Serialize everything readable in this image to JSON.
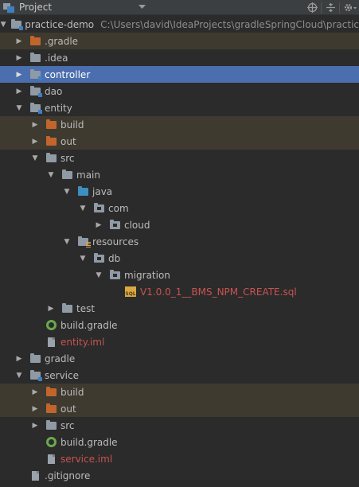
{
  "panel": {
    "title": "Project"
  },
  "colors": {
    "selected": "#4b6eaf",
    "excluded": "#3e3a30",
    "error_file": "#c75450"
  },
  "tree": [
    {
      "label": "practice-demo",
      "path": "C:\\Users\\david\\IdeaProjects\\gradleSpringCloud\\practic",
      "icon": "module-folder-icon",
      "arrow": "expanded"
    },
    {
      "label": ".gradle",
      "icon": "excluded-folder-icon",
      "arrow": "collapsed"
    },
    {
      "label": ".idea",
      "icon": "folder-icon",
      "arrow": "collapsed"
    },
    {
      "label": "controller",
      "icon": "module-folder-icon",
      "arrow": "collapsed"
    },
    {
      "label": "dao",
      "icon": "module-folder-icon",
      "arrow": "collapsed"
    },
    {
      "label": "entity",
      "icon": "module-folder-icon",
      "arrow": "expanded"
    },
    {
      "label": "build",
      "icon": "excluded-folder-icon",
      "arrow": "collapsed"
    },
    {
      "label": "out",
      "icon": "excluded-folder-icon",
      "arrow": "collapsed"
    },
    {
      "label": "src",
      "icon": "folder-icon",
      "arrow": "expanded"
    },
    {
      "label": "main",
      "icon": "folder-icon",
      "arrow": "expanded"
    },
    {
      "label": "java",
      "icon": "source-folder-icon",
      "arrow": "expanded"
    },
    {
      "label": "com",
      "icon": "package-icon",
      "arrow": "expanded"
    },
    {
      "label": "cloud",
      "icon": "package-icon",
      "arrow": "collapsed"
    },
    {
      "label": "resources",
      "icon": "resources-folder-icon",
      "arrow": "expanded"
    },
    {
      "label": "db",
      "icon": "package-icon",
      "arrow": "expanded"
    },
    {
      "label": "migration",
      "icon": "package-icon",
      "arrow": "expanded"
    },
    {
      "label": "V1.0.0_1__BMS_NPM_CREATE.sql",
      "icon": "sql-file-icon",
      "arrow": "none"
    },
    {
      "label": "test",
      "icon": "folder-icon",
      "arrow": "collapsed"
    },
    {
      "label": "build.gradle",
      "icon": "gradle-icon",
      "arrow": "none"
    },
    {
      "label": "entity.iml",
      "icon": "iml-file-icon",
      "arrow": "none"
    },
    {
      "label": "gradle",
      "icon": "folder-icon",
      "arrow": "collapsed"
    },
    {
      "label": "service",
      "icon": "module-folder-icon",
      "arrow": "expanded"
    },
    {
      "label": "build",
      "icon": "excluded-folder-icon",
      "arrow": "collapsed"
    },
    {
      "label": "out",
      "icon": "excluded-folder-icon",
      "arrow": "collapsed"
    },
    {
      "label": "src",
      "icon": "folder-icon",
      "arrow": "collapsed"
    },
    {
      "label": "build.gradle",
      "icon": "gradle-icon",
      "arrow": "none"
    },
    {
      "label": "service.iml",
      "icon": "iml-file-icon",
      "arrow": "none"
    },
    {
      "label": ".gitignore",
      "icon": "file-icon",
      "arrow": "none"
    }
  ]
}
